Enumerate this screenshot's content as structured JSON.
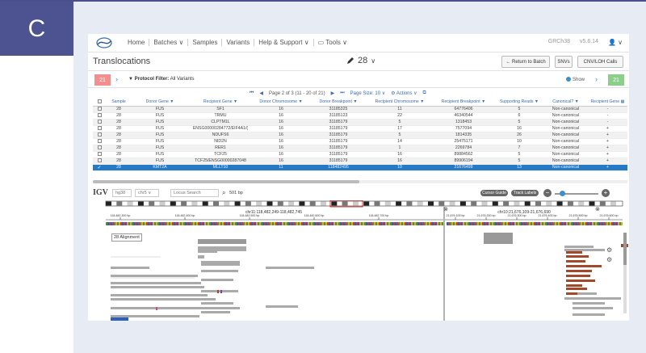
{
  "panel_letter": "C",
  "nav": {
    "items": [
      "Home",
      "Batches ∨",
      "Samples",
      "Variants",
      "Help & Support ∨",
      "▭ Tools ∨"
    ],
    "genome": "GRCh38",
    "version": "v5.6.14",
    "user": "👤 ∨"
  },
  "header": {
    "title": "Translocations",
    "sample": "28",
    "buttons": [
      "← Return to Batch",
      "SNVs",
      "CNV/LOH Calls"
    ]
  },
  "filter": {
    "left_count": "21",
    "label_prefix": "Protocol Filter:",
    "label_value": "All Variants",
    "show": "Show",
    "right_count": "21"
  },
  "pager": {
    "page_info": "Page 2 of 3 (11 - 20 of 21)",
    "page_size": "Page Size: 10 ∨",
    "actions": "Actions ∨"
  },
  "table": {
    "columns": [
      "",
      "Sample",
      "Donor Gene ▼",
      "Recipient Gene ▼",
      "Donor Chromosome ▼",
      "Donor Breakpoint ▼",
      "Recipient Chromosome ▼",
      "Recipient Breakpoint ▼",
      "Supporting Reads ▼",
      "Canonical? ▼",
      "Recipient Gene ▦"
    ],
    "rows": [
      [
        "28",
        "FUS",
        "SF1",
        "16",
        "31185325",
        "11",
        "64776406",
        "5",
        "Non-canonical",
        "-"
      ],
      [
        "28",
        "FUS",
        "TRMU",
        "16",
        "31185123",
        "22",
        "46340544",
        "6",
        "Non-canonical",
        "-"
      ],
      [
        "28",
        "FUS",
        "CLPTM1L",
        "16",
        "31185179",
        "5",
        "1318453",
        "5",
        "Non-canonical",
        "-"
      ],
      [
        "28",
        "FUS",
        "ENSG00000284772/EIF4A1/(",
        "16",
        "31185179",
        "17",
        "7577094",
        "16",
        "Non-canonical",
        "+"
      ],
      [
        "28",
        "FUS",
        "NDUFS6",
        "16",
        "31185179",
        "5",
        "1814335",
        "26",
        "Non-canonical",
        "+"
      ],
      [
        "28",
        "FUS",
        "NID2N",
        "16",
        "31185179",
        "14",
        "25475171",
        "10",
        "Non-canonical",
        "+"
      ],
      [
        "28",
        "FUS",
        "RER1",
        "16",
        "31185179",
        "1",
        "2269784",
        "7",
        "Non-canonical",
        "+"
      ],
      [
        "28",
        "FUS",
        "TCF25",
        "16",
        "31185179",
        "16",
        "89884562",
        "5",
        "Non-canonical",
        "+"
      ],
      [
        "28",
        "FUS",
        "TCF25/ENSG00000287048",
        "16",
        "31185179",
        "16",
        "89906194",
        "5",
        "Non-canonical",
        "+"
      ],
      [
        "28",
        "KMT2A",
        "MLLT10",
        "11",
        "118482495",
        "10",
        "21676499",
        "13",
        "Non-canonical",
        "+"
      ]
    ]
  },
  "igv": {
    "logo": "IGV",
    "genome": "hg38",
    "chrom": "chr5 ∨",
    "locus_placeholder": "Locus Search",
    "width": "501 bp",
    "cursor_guide": "Cursor Guide",
    "track_labels": "Track Labels",
    "locus_left": "chr11:118,482,249-118,482,745",
    "locus_right": "chr10:21,676,109-21,676,690",
    "ticks_left": [
      "118,482,300 bp",
      "118,482,400 bp",
      "118,482,500 bp",
      "118,482,600 bp",
      "118,482,700 bp"
    ],
    "ticks_right": [
      "21,676,100 bp",
      "21,676,200 bp",
      "21,676,300 bp",
      "21,676,400 bp",
      "21,676,500 bp",
      "21,676,600 bp"
    ],
    "alignment_label": "28 Alignment",
    "colors": {
      "gray_read": "#aaaaaa",
      "red_read": "#a1492a",
      "selected_row": "#2679c5"
    }
  }
}
